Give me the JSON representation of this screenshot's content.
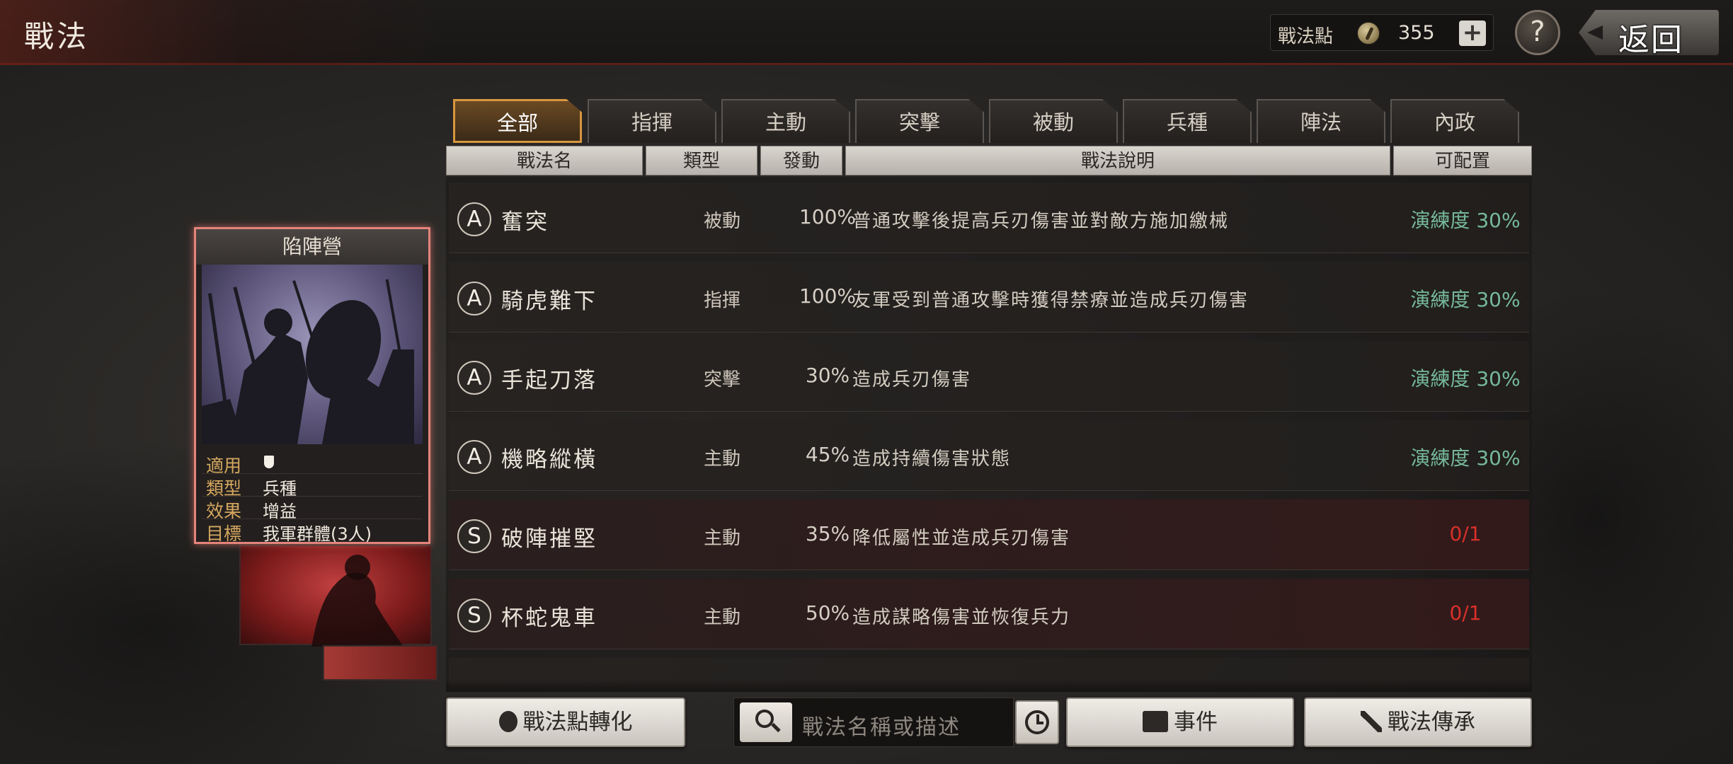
{
  "header": {
    "title": "戰法",
    "points_label": "戰法點",
    "points_value": "355",
    "plus_label": "+",
    "help_label": "?",
    "back_label": "返回"
  },
  "tabs": [
    {
      "label": "全部",
      "active": true
    },
    {
      "label": "指揮"
    },
    {
      "label": "主動"
    },
    {
      "label": "突擊"
    },
    {
      "label": "被動"
    },
    {
      "label": "兵種"
    },
    {
      "label": "陣法"
    },
    {
      "label": "內政"
    }
  ],
  "columns": [
    "戰法名",
    "類型",
    "發動",
    "戰法說明",
    "可配置"
  ],
  "rows": [
    {
      "grade": "A",
      "name": "奮突",
      "type": "被動",
      "rate": "100%",
      "desc": "普通攻擊後提高兵刃傷害並對敵方施加繳械",
      "status": "演練度 30%",
      "status_color": "green"
    },
    {
      "grade": "A",
      "name": "騎虎難下",
      "type": "指揮",
      "rate": "100%",
      "desc": "友軍受到普通攻擊時獲得禁療並造成兵刃傷害",
      "status": "演練度 30%",
      "status_color": "green"
    },
    {
      "grade": "A",
      "name": "手起刀落",
      "type": "突擊",
      "rate": "30%",
      "desc": "造成兵刃傷害",
      "status": "演練度 30%",
      "status_color": "green"
    },
    {
      "grade": "A",
      "name": "機略縱橫",
      "type": "主動",
      "rate": "45%",
      "desc": "造成持續傷害狀態",
      "status": "演練度 30%",
      "status_color": "green"
    },
    {
      "grade": "S",
      "name": "破陣摧堅",
      "type": "主動",
      "rate": "35%",
      "desc": "降低屬性並造成兵刃傷害",
      "status": "0/1",
      "status_color": "red"
    },
    {
      "grade": "S",
      "name": "杯蛇鬼車",
      "type": "主動",
      "rate": "50%",
      "desc": "造成謀略傷害並恢復兵力",
      "status": "0/1",
      "status_color": "red"
    }
  ],
  "card": {
    "title": "陷陣營",
    "info": [
      {
        "key": "適用",
        "value": ""
      },
      {
        "key": "類型",
        "value": "兵種"
      },
      {
        "key": "效果",
        "value": "增益"
      },
      {
        "key": "目標",
        "value": "我軍群體(3人)"
      }
    ],
    "applies_icon": "shield-icon"
  },
  "bottom": {
    "convert_label": "戰法點轉化",
    "search_placeholder": "戰法名稱或描述",
    "event_label": "事件",
    "inherit_label": "戰法傳承"
  },
  "colors": {
    "accent_gold": "#d7973e",
    "practice_green": "#76b89a",
    "limit_red": "#d8302a",
    "card_border": "#e4847b"
  }
}
